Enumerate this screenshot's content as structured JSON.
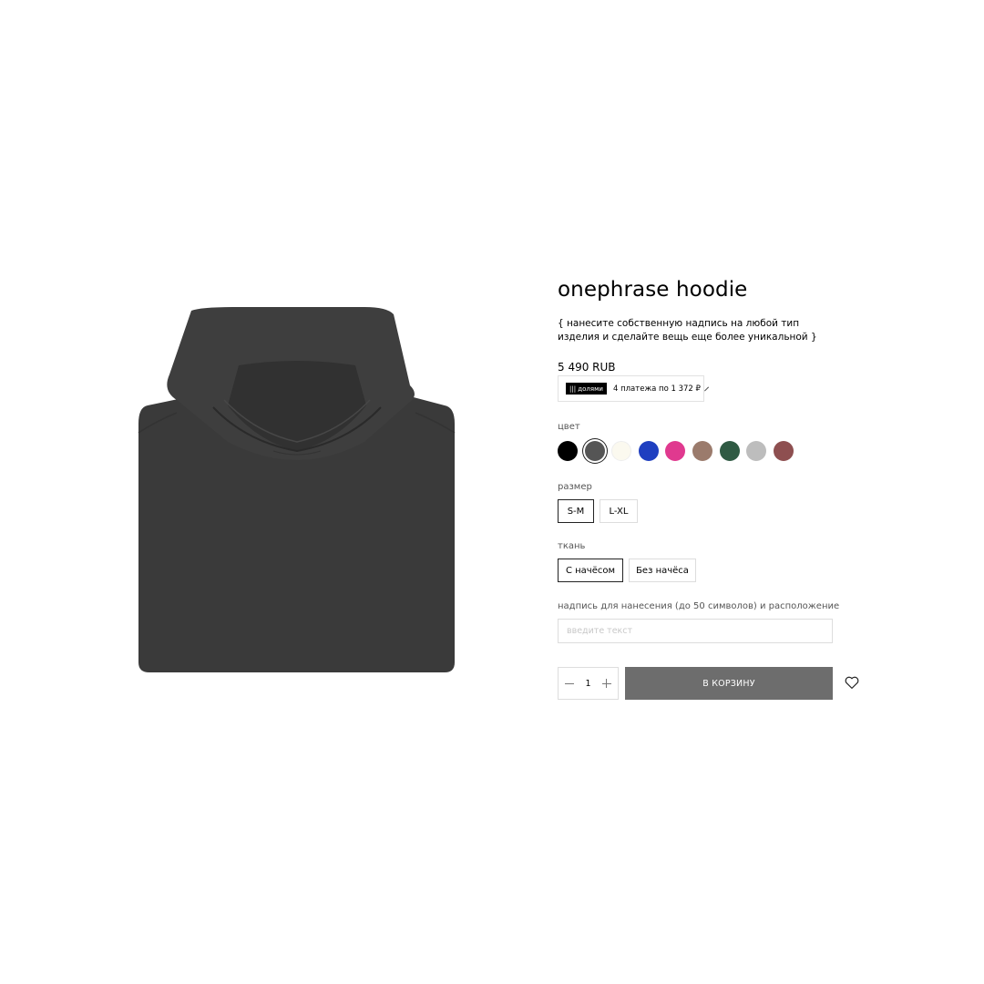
{
  "product": {
    "title": "onephrase hoodie",
    "description": "{ нанесите собственную надпись на любой тип изделия и сделайте вещь еще более уникальной }",
    "price": "5 490 RUB",
    "image_icon": "hoodie-image"
  },
  "dolyami": {
    "logo": "||| долями",
    "text": "4 платежа по 1 372 ₽",
    "icon": "chevron-right-icon"
  },
  "color": {
    "label": "цвет",
    "selected_index": 1,
    "swatches": [
      "#000000",
      "#555555",
      "#fbf9ef",
      "#1f3fc0",
      "#e0398f",
      "#9b7b6c",
      "#2f5a43",
      "#bdbdbd",
      "#8e4f50"
    ]
  },
  "size": {
    "label": "размер",
    "options": [
      "S-M",
      "L-XL"
    ],
    "selected": "S-M"
  },
  "fabric": {
    "label": "ткань",
    "options": [
      "С начёсом",
      "Без начёса"
    ],
    "selected": "С начёсом"
  },
  "inscription": {
    "label": "надпись для нанесения (до 50 символов) и расположение",
    "placeholder": "введите текст",
    "value": ""
  },
  "cart": {
    "quantity": "1",
    "button_label": "В КОРЗИНУ",
    "wishlist_icon": "heart-icon"
  }
}
